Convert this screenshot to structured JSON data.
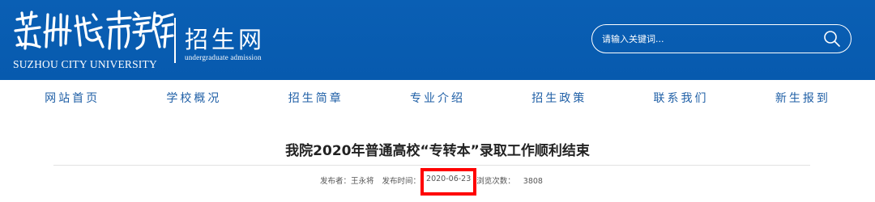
{
  "header": {
    "logo_calligraphy": "苏州城市学院",
    "logo_en": "SUZHOU CITY UNIVERSITY",
    "site_name": "招生网",
    "site_sub": "undergraduate admission"
  },
  "search": {
    "placeholder": "请输入关键词...",
    "icon": "search-icon"
  },
  "nav": {
    "items": [
      {
        "label": "网站首页"
      },
      {
        "label": "学校概况"
      },
      {
        "label": "招生简章"
      },
      {
        "label": "专业介绍"
      },
      {
        "label": "招生政策"
      },
      {
        "label": "联系我们"
      },
      {
        "label": "新生报到"
      }
    ]
  },
  "article": {
    "title": "我院2020年普通高校“专转本”录取工作顺利结束",
    "publisher_label": "发布者：",
    "publisher": "王永将",
    "time_label": "发布时间：",
    "date": "2020-06-23",
    "views_label": "浏览次数：",
    "views": "3808"
  },
  "colors": {
    "header_bg": "#0a5fb4",
    "nav_text": "#1f5fa6",
    "highlight": "#ff0000"
  }
}
